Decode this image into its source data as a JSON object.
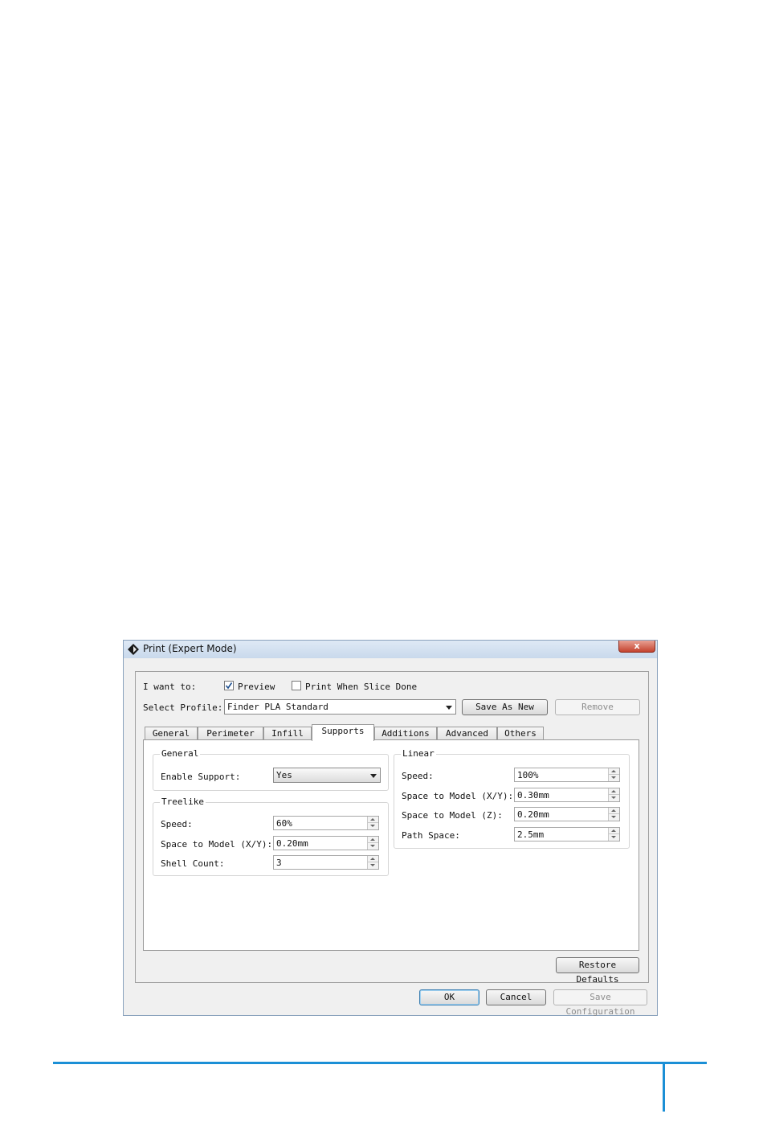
{
  "window": {
    "title": "Print (Expert Mode)",
    "close_glyph": "x"
  },
  "options": {
    "i_want_to_label": "I want to:",
    "preview": {
      "label": "Preview",
      "checked": true
    },
    "print_when_done": {
      "label": "Print When Slice Done",
      "checked": false
    }
  },
  "profile": {
    "label": "Select Profile:",
    "value": "Finder PLA Standard",
    "save_as_new": "Save As New",
    "remove": "Remove"
  },
  "tabs": [
    {
      "label": "General"
    },
    {
      "label": "Perimeter"
    },
    {
      "label": "Infill"
    },
    {
      "label": "Supports",
      "active": true
    },
    {
      "label": "Additions"
    },
    {
      "label": "Advanced"
    },
    {
      "label": "Others"
    }
  ],
  "supports": {
    "general": {
      "title": "General",
      "enable_label": "Enable Support:",
      "enable_value": "Yes"
    },
    "treelike": {
      "title": "Treelike",
      "speed_label": "Speed:",
      "speed_value": "60%",
      "space_xy_label": "Space to Model (X/Y):",
      "space_xy_value": "0.20mm",
      "shell_label": "Shell Count:",
      "shell_value": "3"
    },
    "linear": {
      "title": "Linear",
      "speed_label": "Speed:",
      "speed_value": "100%",
      "space_xy_label": "Space to Model (X/Y):",
      "space_xy_value": "0.30mm",
      "space_z_label": "Space to Model (Z):",
      "space_z_value": "0.20mm",
      "path_label": "Path Space:",
      "path_value": "2.5mm"
    }
  },
  "buttons": {
    "restore_defaults": "Restore Defaults",
    "ok": "OK",
    "cancel": "Cancel",
    "save_configuration": "Save Configuration"
  },
  "colors": {
    "footer_accent": "#1b8fd6",
    "title_bar": "#c9d9ec"
  }
}
